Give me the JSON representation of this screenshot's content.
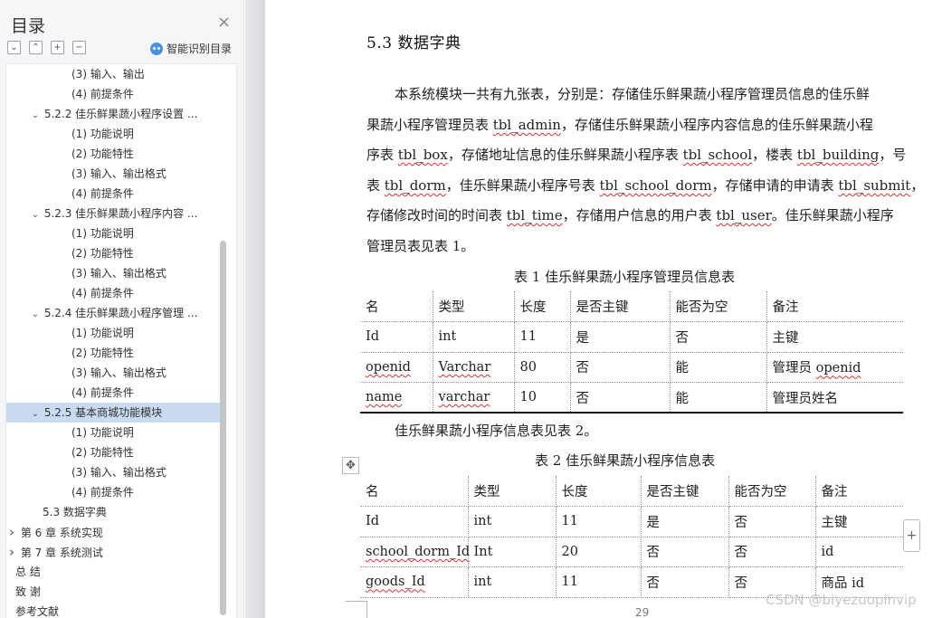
{
  "sidebar": {
    "title": "目录",
    "close_symbol": "×",
    "smart_toc_label": "智能识别目录",
    "tools": [
      {
        "icon": "collapse-all-icon",
        "glyph": "⌄"
      },
      {
        "icon": "expand-all-icon",
        "glyph": "⌃"
      },
      {
        "icon": "add-heading-icon",
        "glyph": "+"
      },
      {
        "icon": "remove-heading-icon",
        "glyph": "−"
      }
    ],
    "toc": [
      {
        "label": "(3)  输入、输出",
        "level": 3,
        "arrow": ""
      },
      {
        "label": "(4)  前提条件",
        "level": 3,
        "arrow": ""
      },
      {
        "label": "5.2.2  佳乐鲜果蔬小程序设置 ...",
        "level": 2,
        "arrow": "expanded"
      },
      {
        "label": "(1)  功能说明",
        "level": 3,
        "arrow": ""
      },
      {
        "label": "(2)  功能特性",
        "level": 3,
        "arrow": ""
      },
      {
        "label": "(3)  输入、输出格式",
        "level": 3,
        "arrow": ""
      },
      {
        "label": "(4)  前提条件",
        "level": 3,
        "arrow": ""
      },
      {
        "label": "5.2.3  佳乐鲜果蔬小程序内容 ...",
        "level": 2,
        "arrow": "expanded"
      },
      {
        "label": "(1)  功能说明",
        "level": 3,
        "arrow": ""
      },
      {
        "label": "(2)  功能特性",
        "level": 3,
        "arrow": ""
      },
      {
        "label": "(3)  输入、输出格式",
        "level": 3,
        "arrow": ""
      },
      {
        "label": "(4)  前提条件",
        "level": 3,
        "arrow": ""
      },
      {
        "label": "5.2.4  佳乐鲜果蔬小程序管理 ...",
        "level": 2,
        "arrow": "expanded"
      },
      {
        "label": "(1)  功能说明",
        "level": 3,
        "arrow": ""
      },
      {
        "label": "(2)  功能特性",
        "level": 3,
        "arrow": ""
      },
      {
        "label": "(3)  输入、输出格式",
        "level": 3,
        "arrow": ""
      },
      {
        "label": "(4)  前提条件",
        "level": 3,
        "arrow": ""
      },
      {
        "label": "5.2.5  基本商城功能模块",
        "level": 2,
        "arrow": "expanded",
        "selected": true
      },
      {
        "label": "(1)  功能说明",
        "level": 3,
        "arrow": ""
      },
      {
        "label": "(2)  功能特性",
        "level": 3,
        "arrow": ""
      },
      {
        "label": "(3)  输入、输出格式",
        "level": 3,
        "arrow": ""
      },
      {
        "label": "(4)  前提条件",
        "level": 3,
        "arrow": ""
      },
      {
        "label": "5.3  数据字典",
        "level": 1.5,
        "arrow": ""
      },
      {
        "label": "第 6 章  系统实现",
        "level": 1,
        "arrow": "collapsed"
      },
      {
        "label": "第 7 章  系统测试",
        "level": 1,
        "arrow": "collapsed"
      },
      {
        "label": "总    结",
        "level": 1,
        "arrow": ""
      },
      {
        "label": "致    谢",
        "level": 1,
        "arrow": ""
      },
      {
        "label": "参考文献",
        "level": 1,
        "arrow": ""
      }
    ]
  },
  "document": {
    "heading": "5.3  数据字典",
    "paragraph_lines": [
      [
        {
          "t": "本系统模块一共有九张表，分别是：存储佳乐鲜果蔬小程序管理员信息的佳乐鲜"
        }
      ],
      [
        {
          "t": "果蔬小程序管理员表 "
        },
        {
          "t": "tbl_admin",
          "code": true
        },
        {
          "t": "，存储佳乐鲜果蔬小程序内容信息的佳乐鲜果蔬小程"
        }
      ],
      [
        {
          "t": "序表 "
        },
        {
          "t": "tbl_box",
          "code": true
        },
        {
          "t": "，存储地址信息的佳乐鲜果蔬小程序表 "
        },
        {
          "t": "tbl_school",
          "code": true
        },
        {
          "t": "，楼表 "
        },
        {
          "t": "tbl_building",
          "code": true
        },
        {
          "t": "，号"
        }
      ],
      [
        {
          "t": "表 "
        },
        {
          "t": "tbl_dorm",
          "code": true
        },
        {
          "t": "，佳乐鲜果蔬小程序号表 "
        },
        {
          "t": "tbl_school_dorm",
          "code": true
        },
        {
          "t": "，存储申请的申请表 "
        },
        {
          "t": "tbl_submit",
          "code": true
        },
        {
          "t": "，"
        }
      ],
      [
        {
          "t": "存储修改时间的时间表 "
        },
        {
          "t": "tbl_time",
          "code": true
        },
        {
          "t": "，存储用户信息的用户表 "
        },
        {
          "t": "tbl_user",
          "code": true
        },
        {
          "t": "。佳乐鲜果蔬小程序"
        }
      ],
      [
        {
          "t": "管理员表见表 1。"
        }
      ]
    ],
    "table1": {
      "caption": "表 1  佳乐鲜果蔬小程序管理员信息表",
      "rows": [
        [
          "名",
          "类型",
          "长度",
          "是否主键",
          "能否为空",
          "备注"
        ],
        [
          "Id",
          "int",
          "11",
          "是",
          "否",
          "主键"
        ],
        [
          "openid",
          "Varchar",
          "80",
          "否",
          "能",
          "管理员 openid"
        ],
        [
          "name",
          "varchar",
          "10",
          "否",
          "能",
          "管理员姓名"
        ]
      ]
    },
    "between_text": "佳乐鲜果蔬小程序信息表见表 2。",
    "table2": {
      "caption": "表 2  佳乐鲜果蔬小程序信息表",
      "rows": [
        [
          "名",
          "类型",
          "长度",
          "是否主键",
          "能否为空",
          "备注"
        ],
        [
          "Id",
          "int",
          "11",
          "是",
          "否",
          "主键"
        ],
        [
          "school_dorm_Id",
          "Int",
          "20",
          "否",
          "否",
          "id"
        ],
        [
          "goods_Id",
          "int",
          "11",
          "否",
          "否",
          "商品 id"
        ]
      ]
    },
    "move_handle_glyph": "✥",
    "add_column_glyph": "+",
    "page_number": "29"
  },
  "watermark": "CSDN @biyezuopinvip"
}
